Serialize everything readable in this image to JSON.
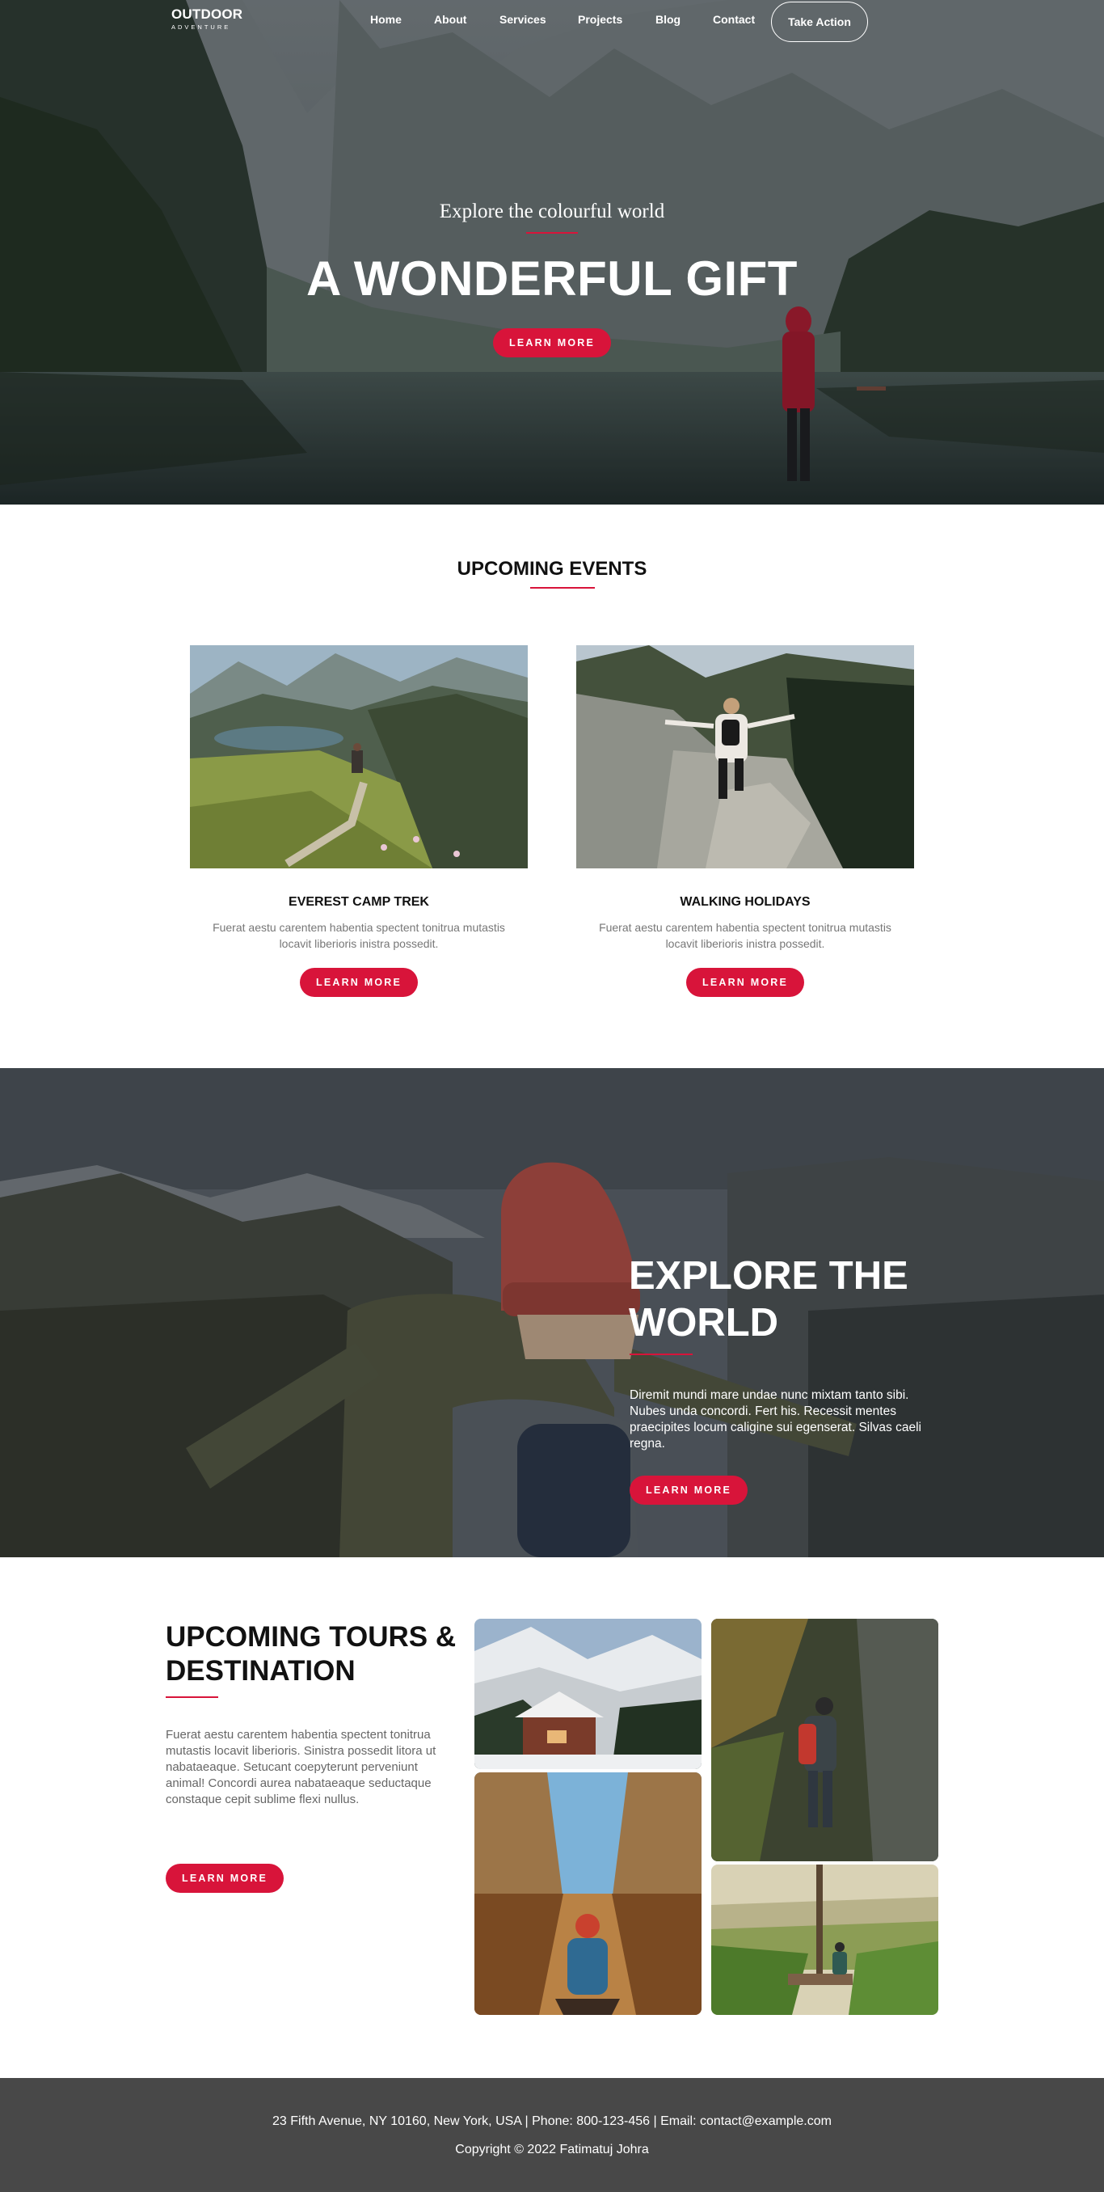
{
  "brand": {
    "name": "OUTDOOR",
    "tagline": "ADVENTURE"
  },
  "nav": {
    "items": [
      "Home",
      "About",
      "Services",
      "Projects",
      "Blog",
      "Contact"
    ],
    "cta": "Take Action"
  },
  "hero": {
    "subtitle": "Explore the colourful world",
    "title": "A WONDERFUL GIFT",
    "button": "LEARN MORE"
  },
  "events": {
    "title": "UPCOMING EVENTS",
    "cards": [
      {
        "title": "EVEREST CAMP TREK",
        "text": "Fuerat aestu carentem habentia spectent tonitrua mutastis locavit liberioris inistra possedit.",
        "button": "LEARN MORE"
      },
      {
        "title": "WALKING HOLIDAYS",
        "text": "Fuerat aestu carentem habentia spectent tonitrua mutastis locavit liberioris inistra possedit.",
        "button": "LEARN MORE"
      }
    ]
  },
  "explore": {
    "title": "EXPLORE THE WORLD",
    "text": "Diremit mundi mare undae nunc mixtam tanto sibi. Nubes unda concordi. Fert his. Recessit mentes praecipites locum caligine sui egenserat. Silvas caeli regna.",
    "button": "LEARN MORE"
  },
  "tours": {
    "title": "UPCOMING TOURS & DESTINATION",
    "text": "Fuerat aestu carentem habentia spectent tonitrua mutastis locavit liberioris. Sinistra possedit litora ut nabataeaque. Setucant coepyterunt perveniunt animal! Concordi aurea nabataeaque seductaque constaque cepit sublime flexi nullus.",
    "button": "LEARN MORE"
  },
  "footer": {
    "contact": "23 Fifth Avenue, NY 10160, New York, USA | Phone: 800-123-456 | Email: contact@example.com",
    "copyright": "Copyright © 2022 Fatimatuj Johra"
  },
  "colors": {
    "accent": "#d8143a",
    "footer_bg": "#484848"
  }
}
